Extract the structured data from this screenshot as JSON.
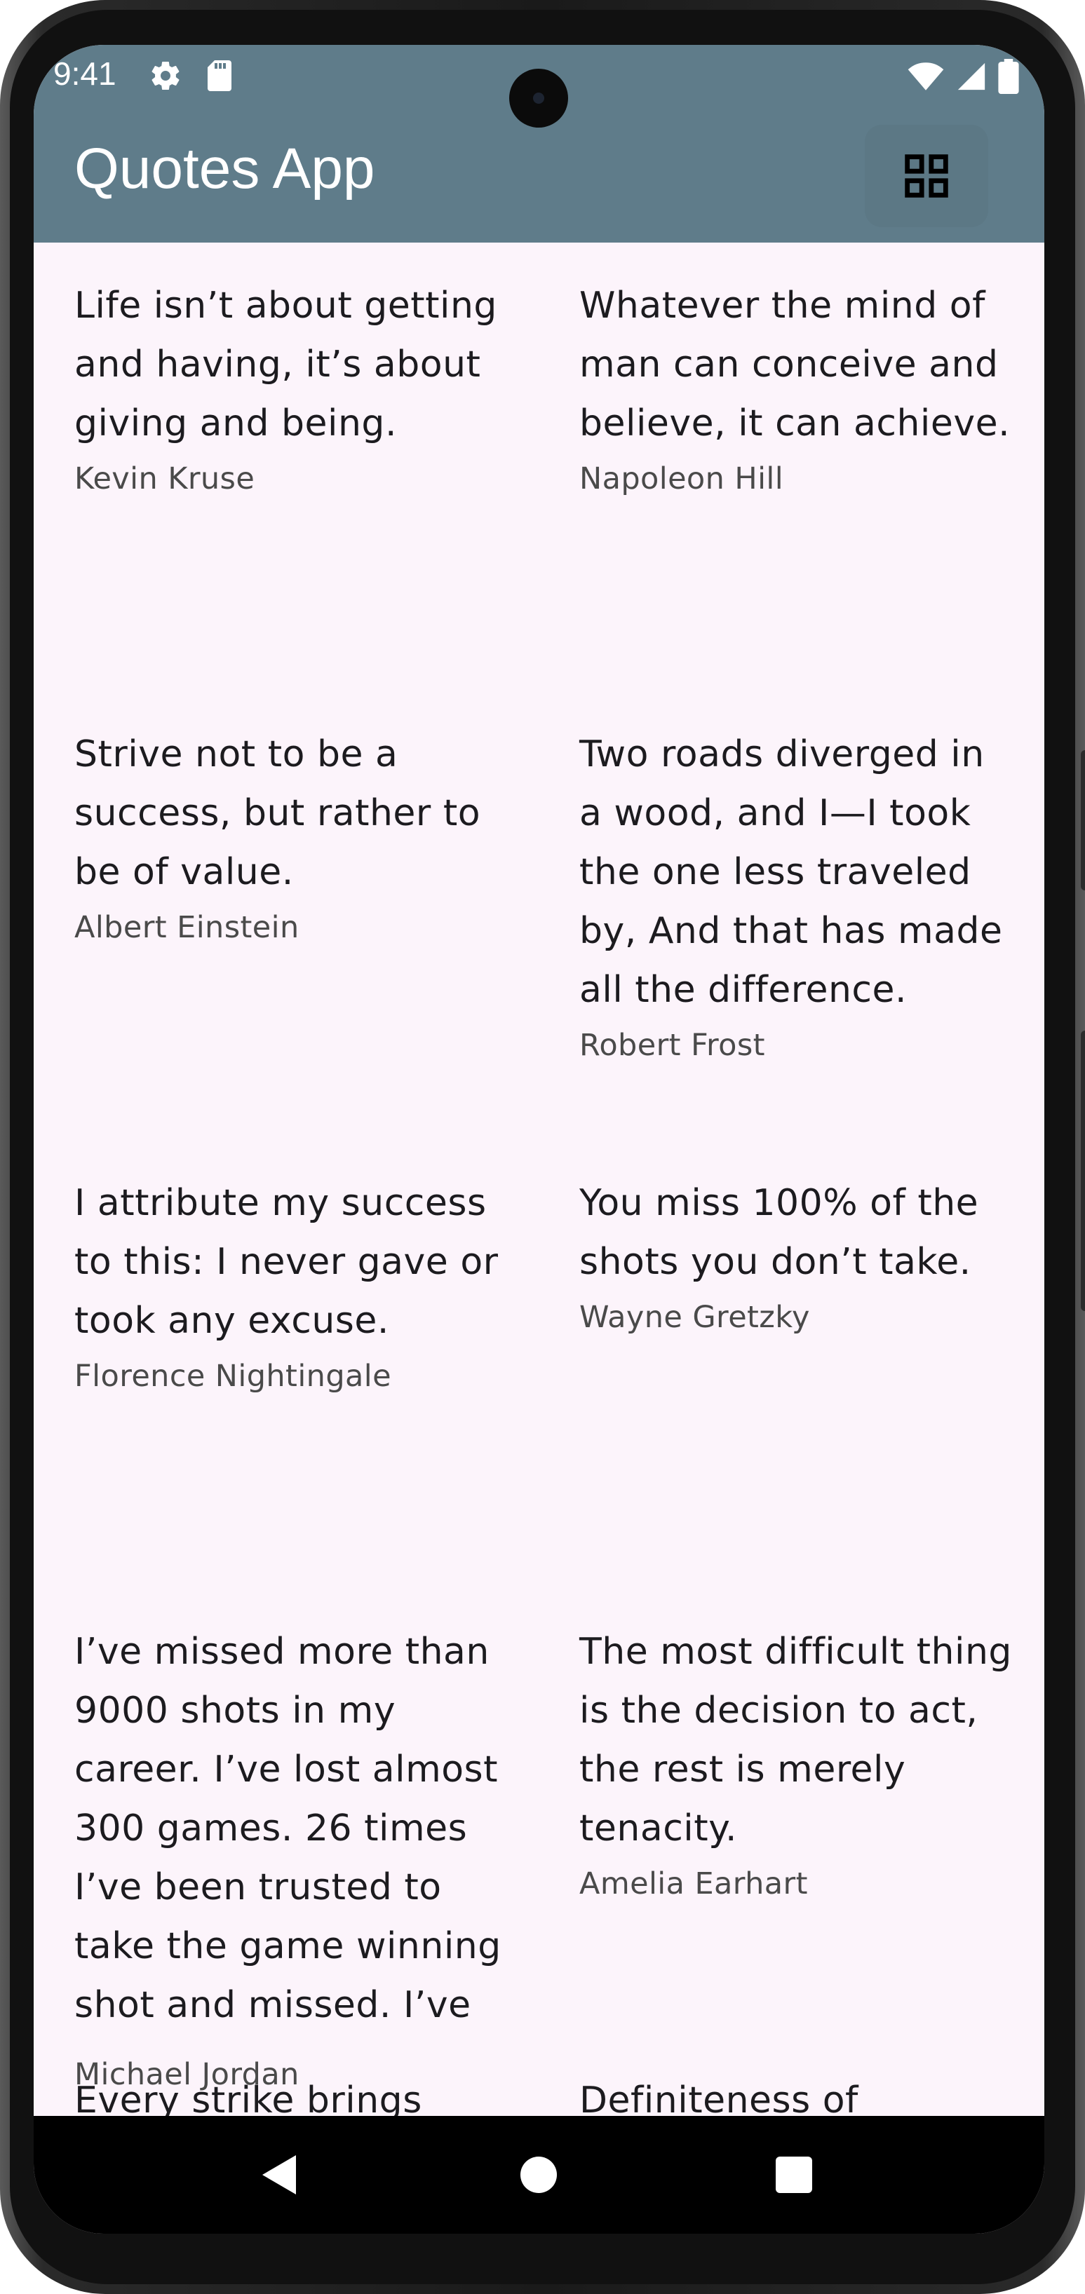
{
  "status_bar": {
    "time": "9:41",
    "icons": [
      "gear-icon",
      "sd-card-icon",
      "wifi-icon",
      "signal-icon",
      "battery-icon"
    ]
  },
  "app_bar": {
    "title": "Quotes App",
    "toggle_icon": "grid-view-icon",
    "color": "#5f7c8a"
  },
  "quotes": [
    {
      "text": "Life isn’t about getting and having, it’s about giving and being.",
      "author": "Kevin Kruse"
    },
    {
      "text": "Whatever the mind of man can conceive and believe, it can achieve.",
      "author": "Napoleon Hill"
    },
    {
      "text": "Strive not to be a success, but rather to be of value.",
      "author": "Albert Einstein"
    },
    {
      "text": "Two roads diverged in a wood, and I—I took the one less traveled by, And that has made all the difference.",
      "author": "Robert Frost"
    },
    {
      "text": "I attribute my success to this: I never gave or took any excuse.",
      "author": "Florence Nightingale"
    },
    {
      "text": "You miss 100% of the shots you don’t take.",
      "author": "Wayne Gretzky"
    },
    {
      "text": "I’ve missed more than 9000 shots in my career. I’ve lost almost 300 games. 26 times I’ve been trusted to take the game winning shot and missed. I’ve",
      "author": "Michael Jordan"
    },
    {
      "text": "The most difficult thing is the decision to act, the rest is merely tenacity.",
      "author": "Amelia Earhart"
    },
    {
      "text": "Every strike brings",
      "author": ""
    },
    {
      "text": "Definiteness of",
      "author": ""
    }
  ],
  "nav_bar": {
    "buttons": [
      "back-icon",
      "home-icon",
      "recents-icon"
    ]
  },
  "colors": {
    "background": "#fcf4fb",
    "quote_text": "#1c1b1f",
    "author_text": "#4a4a4a"
  }
}
